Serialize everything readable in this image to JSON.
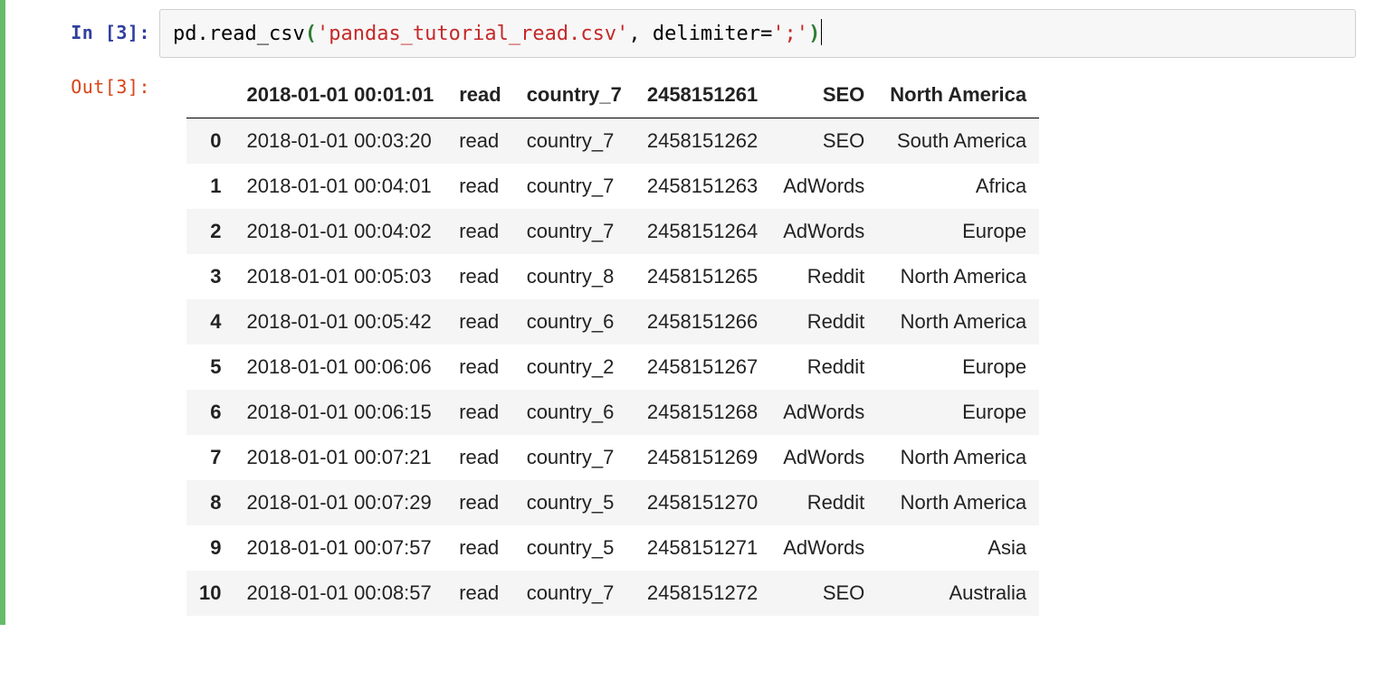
{
  "cell": {
    "prompt_in": "In [3]:",
    "prompt_out": "Out[3]:",
    "code": {
      "obj": "pd",
      "dot": ".",
      "fn": "read_csv",
      "open": "(",
      "arg_str": "'pandas_tutorial_read.csv'",
      "comma": ", ",
      "kwarg": "delimiter",
      "eq": "=",
      "kwval": "';'",
      "close": ")"
    }
  },
  "table": {
    "headers": [
      "2018-01-01 00:01:01",
      "read",
      "country_7",
      "2458151261",
      "SEO",
      "North America"
    ],
    "rows": [
      {
        "idx": "0",
        "c": [
          "2018-01-01 00:03:20",
          "read",
          "country_7",
          "2458151262",
          "SEO",
          "South America"
        ]
      },
      {
        "idx": "1",
        "c": [
          "2018-01-01 00:04:01",
          "read",
          "country_7",
          "2458151263",
          "AdWords",
          "Africa"
        ]
      },
      {
        "idx": "2",
        "c": [
          "2018-01-01 00:04:02",
          "read",
          "country_7",
          "2458151264",
          "AdWords",
          "Europe"
        ]
      },
      {
        "idx": "3",
        "c": [
          "2018-01-01 00:05:03",
          "read",
          "country_8",
          "2458151265",
          "Reddit",
          "North America"
        ]
      },
      {
        "idx": "4",
        "c": [
          "2018-01-01 00:05:42",
          "read",
          "country_6",
          "2458151266",
          "Reddit",
          "North America"
        ]
      },
      {
        "idx": "5",
        "c": [
          "2018-01-01 00:06:06",
          "read",
          "country_2",
          "2458151267",
          "Reddit",
          "Europe"
        ]
      },
      {
        "idx": "6",
        "c": [
          "2018-01-01 00:06:15",
          "read",
          "country_6",
          "2458151268",
          "AdWords",
          "Europe"
        ]
      },
      {
        "idx": "7",
        "c": [
          "2018-01-01 00:07:21",
          "read",
          "country_7",
          "2458151269",
          "AdWords",
          "North America"
        ]
      },
      {
        "idx": "8",
        "c": [
          "2018-01-01 00:07:29",
          "read",
          "country_5",
          "2458151270",
          "Reddit",
          "North America"
        ]
      },
      {
        "idx": "9",
        "c": [
          "2018-01-01 00:07:57",
          "read",
          "country_5",
          "2458151271",
          "AdWords",
          "Asia"
        ]
      },
      {
        "idx": "10",
        "c": [
          "2018-01-01 00:08:57",
          "read",
          "country_7",
          "2458151272",
          "SEO",
          "Australia"
        ]
      }
    ]
  }
}
